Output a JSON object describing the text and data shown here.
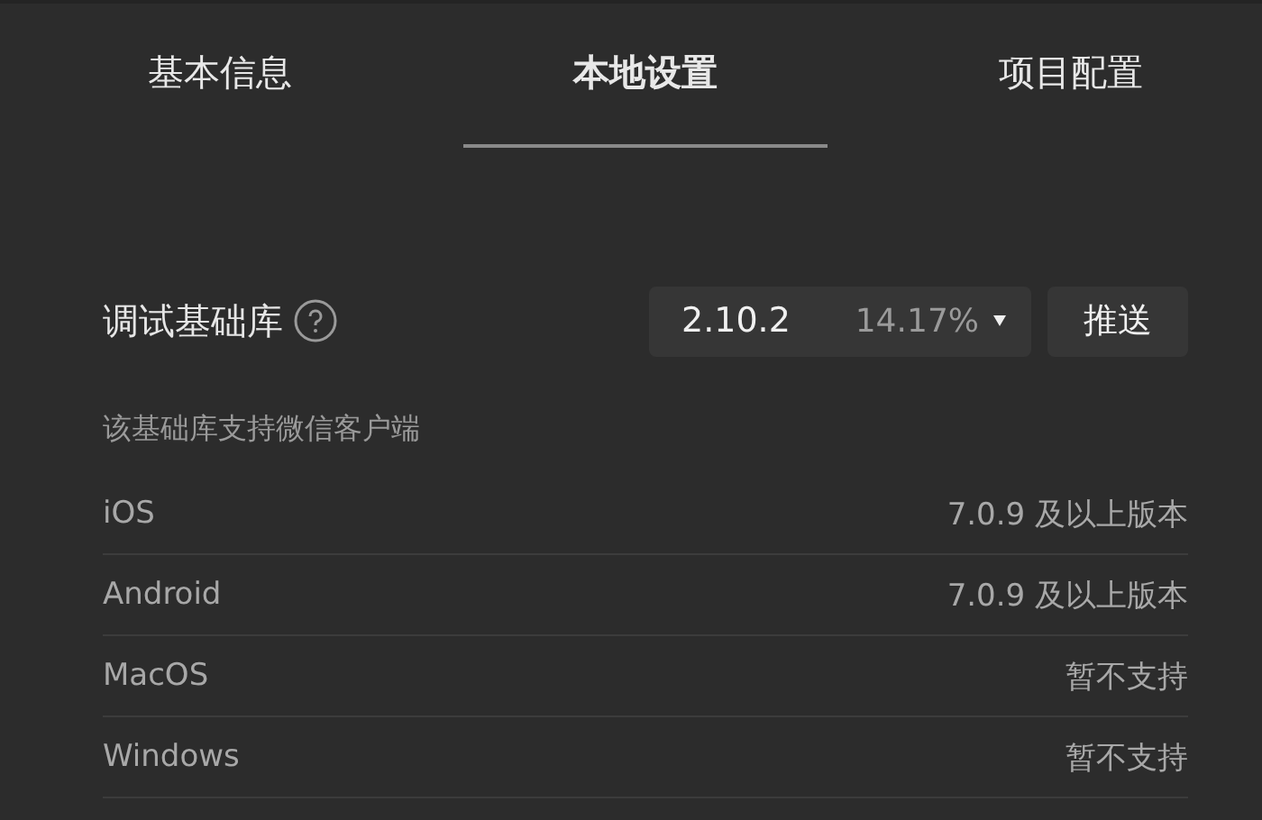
{
  "tabs": [
    {
      "label": "基本信息",
      "selected": false
    },
    {
      "label": "本地设置",
      "selected": true
    },
    {
      "label": "项目配置",
      "selected": false
    }
  ],
  "setting": {
    "label": "调试基础库",
    "version": "2.10.2",
    "share": "14.17%",
    "button": "推送"
  },
  "support": {
    "title": "该基础库支持微信客户端",
    "rows": [
      {
        "platform": "iOS",
        "requirement": "7.0.9 及以上版本"
      },
      {
        "platform": "Android",
        "requirement": "7.0.9 及以上版本"
      },
      {
        "platform": "MacOS",
        "requirement": "暂不支持"
      },
      {
        "platform": "Windows",
        "requirement": "暂不支持"
      }
    ]
  }
}
